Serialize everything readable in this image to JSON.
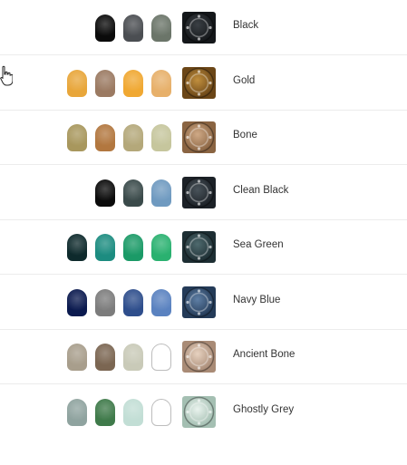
{
  "schemes": [
    {
      "name": "Black",
      "pots": [
        "#0b0b0b",
        "#4b4e52",
        "#6b7569"
      ],
      "sample": [
        "#3a3f44",
        "#14171a"
      ]
    },
    {
      "name": "Gold",
      "pots": [
        "#e8a63a",
        "#9b7a62",
        "#f0a832",
        "#e7b06a"
      ],
      "sample": [
        "#c18f3e",
        "#6b4617"
      ]
    },
    {
      "name": "Bone",
      "pots": [
        "#a8975d",
        "#b2773f",
        "#b4a87a",
        "#c6c69d"
      ],
      "sample": [
        "#cfa986",
        "#8a6442"
      ]
    },
    {
      "name": "Clean Black",
      "pots": [
        "#0b0b0b",
        "#3a4a4a",
        "#6f9ac0"
      ],
      "sample": [
        "#49535a",
        "#1c2127"
      ]
    },
    {
      "name": "Sea Green",
      "pots": [
        "#0e2a2c",
        "#1c8c80",
        "#1b9a67",
        "#2ab170"
      ],
      "sample": [
        "#4f6a6e",
        "#1d2e33"
      ]
    },
    {
      "name": "Navy Blue",
      "pots": [
        "#0b1a4f",
        "#7c7c7c",
        "#2e4e8c",
        "#5a82c0"
      ],
      "sample": [
        "#5f7fa5",
        "#243b58"
      ]
    },
    {
      "name": "Ancient Bone",
      "pots": [
        "#a89e8c",
        "#7b6652",
        "#c9cab8",
        "#ffffff"
      ],
      "sample": [
        "#e7d2c0",
        "#a98b76"
      ]
    },
    {
      "name": "Ghostly Grey",
      "pots": [
        "#8fa39f",
        "#3f7a4a",
        "#c2ded5",
        "#ffffff"
      ],
      "sample": [
        "#eaf3ee",
        "#a4bfb2"
      ]
    }
  ]
}
